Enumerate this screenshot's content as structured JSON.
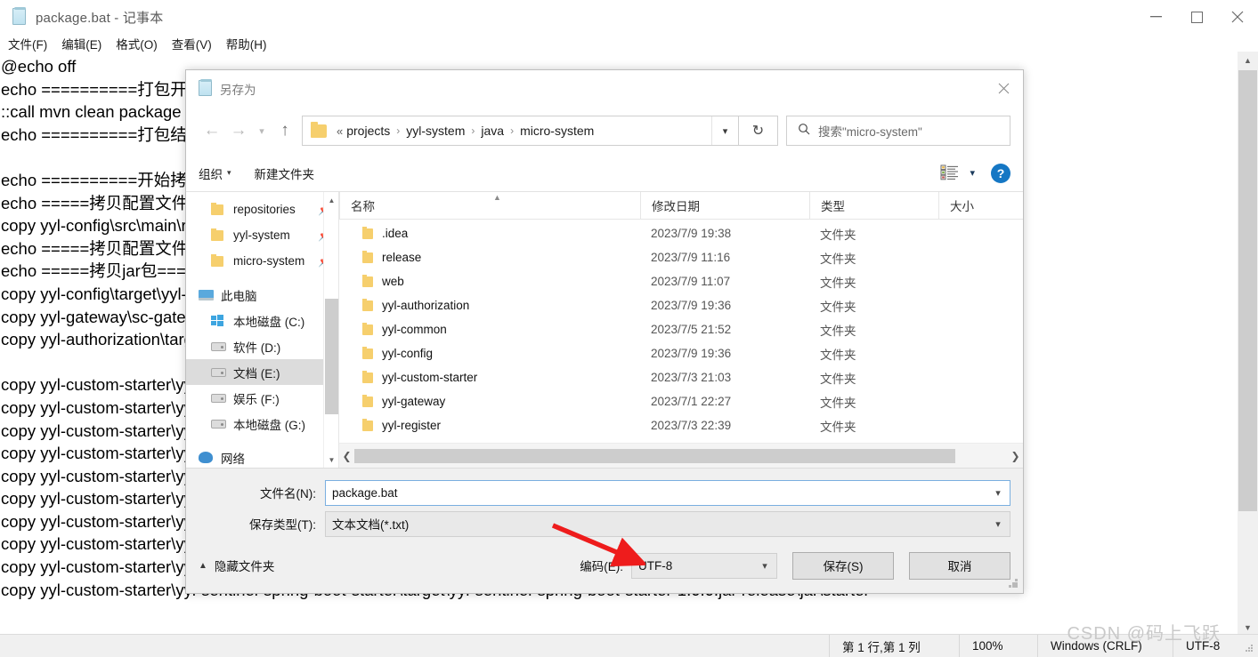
{
  "notepad": {
    "title": "package.bat - 记事本",
    "title_icon": "notepad-icon",
    "window_buttons": {
      "minimize": "minimize-icon",
      "maximize": "maximize-icon",
      "close": "close-icon"
    },
    "menu": [
      {
        "label": "文件(F)"
      },
      {
        "label": "编辑(E)"
      },
      {
        "label": "格式(O)"
      },
      {
        "label": "查看(V)"
      },
      {
        "label": "帮助(H)"
      }
    ],
    "text": "@echo off\necho ==========打包开始==========\n::call mvn clean package -Dmaven.test.skip=true\necho ==========打包结束==========\n\necho ==========开始拷贝==========\necho =====拷贝配置文件=====\ncopy yyl-config\\src\\main\\resources\\config release\\config\necho =====拷贝配置文件完成=====\necho =====拷贝jar包=====\ncopy yyl-config\\target\\yyl-config-1.0.0.jar release\\jar\ncopy yyl-gateway\\sc-gateway\\target\\sc-gateway-1.0.0.jar release\\jar\ncopy yyl-authorization\\target\\yyl-authorization-1.0.0.jar release\\jar\n\ncopy yyl-custom-starter\\yyl-cache-spring-boot-starter\\target\\yyl-cache-spring-boot-starter-1.0.0.jar release\\jar\\starter\ncopy yyl-custom-starter\\yyl-common-spring-boot-starter\\target\\yyl-common-spring-boot-starter-1.0.0.jar release\\jar\\starter\ncopy yyl-custom-starter\\yyl-datasource-spring-boot-starter\\target\\yyl-datasource-1.0.0.jar release\\jar\\starter\ncopy yyl-custom-starter\\yyl-feign-spring-boot-starter\\target\\yyl-feign-spring-boot-starter-1.0.0.jar release\\jar\\starter\ncopy yyl-custom-starter\\yyl-log-spring-boot-starter\\target\\yyl-log-spring-boot-starter-1.0.0.jar release\\jar\\starter\ncopy yyl-custom-starter\\yyl-mybatis-spring-boot-starter\\target\\yyl-mybatis-1.0.0.jar release\\jar\\starter\ncopy yyl-custom-starter\\yyl-oauth-spring-boot-starter\\target\\yyl-oauth-1.0.0.jar release\\jar\\starter\ncopy yyl-custom-starter\\yyl-rabbit-spring-boot-starter\\target\\yyl-rabbit-1.0.0.jar release\\jar\\starter\ncopy yyl-custom-starter\\yyl-redis-spring-boot-starter\\target\\yyl-redis-spring-boot-starter-1.0.0.jar release\\jar\\starter\ncopy yyl-custom-starter\\yyl-sentinel-spring-boot-starter\\target\\yyl-sentinel-spring-boot-starter-1.0.0.jar release\\jar\\starter",
    "statusbar": {
      "position": "第 1 行,第 1 列",
      "zoom": "100%",
      "line_ending": "Windows (CRLF)",
      "encoding": "UTF-8"
    },
    "watermark": "CSDN @码上飞跃"
  },
  "dialog": {
    "title": "另存为",
    "title_icon": "notepad-icon",
    "close_icon": "close-icon",
    "nav": {
      "back_icon": "arrow-left-icon",
      "forward_icon": "arrow-right-icon",
      "history_icon": "chevron-down-icon",
      "up_icon": "arrow-up-icon",
      "refresh_icon": "refresh-icon",
      "folder_icon": "folder-icon",
      "dropdown_icon": "chevron-down-icon",
      "breadcrumb_prefix": "«",
      "breadcrumbs": [
        "projects",
        "yyl-system",
        "java",
        "micro-system"
      ],
      "separator": "›"
    },
    "search": {
      "icon": "search-icon",
      "placeholder": "搜索\"micro-system\""
    },
    "toolbar": {
      "organize": "组织",
      "new_folder": "新建文件夹",
      "view_icon": "view-list-icon",
      "view_caret": "▾",
      "help_icon": "help-icon",
      "help_label": "?"
    },
    "sidebar": {
      "items": [
        {
          "label": "repositories",
          "icon": "folder-icon",
          "indent": true,
          "pinned": true,
          "selected": false
        },
        {
          "label": "yyl-system",
          "icon": "folder-icon",
          "indent": true,
          "pinned": true,
          "selected": false
        },
        {
          "label": "micro-system",
          "icon": "folder-icon",
          "indent": true,
          "pinned": true,
          "selected": false
        },
        {
          "label": "此电脑",
          "icon": "this-pc-icon",
          "indent": false,
          "pinned": false,
          "selected": false
        },
        {
          "label": "本地磁盘 (C:)",
          "icon": "windows-drive-icon",
          "indent": true,
          "pinned": false,
          "selected": false
        },
        {
          "label": "软件 (D:)",
          "icon": "drive-icon",
          "indent": true,
          "pinned": false,
          "selected": false
        },
        {
          "label": "文档 (E:)",
          "icon": "drive-icon",
          "indent": true,
          "pinned": false,
          "selected": true
        },
        {
          "label": "娱乐 (F:)",
          "icon": "drive-icon",
          "indent": true,
          "pinned": false,
          "selected": false
        },
        {
          "label": "本地磁盘 (G:)",
          "icon": "drive-icon",
          "indent": true,
          "pinned": false,
          "selected": false
        },
        {
          "label": "网络",
          "icon": "network-icon",
          "indent": false,
          "pinned": false,
          "selected": false
        }
      ],
      "scroll_up_icon": "chevron-up-icon",
      "scroll_down_icon": "chevron-down-icon"
    },
    "filelist": {
      "columns": [
        "名称",
        "修改日期",
        "类型",
        "大小"
      ],
      "sort_indicator": "▲",
      "rows": [
        {
          "name": ".idea",
          "date": "2023/7/9 19:38",
          "type": "文件夹",
          "size": ""
        },
        {
          "name": "release",
          "date": "2023/7/9 11:16",
          "type": "文件夹",
          "size": ""
        },
        {
          "name": "web",
          "date": "2023/7/9 11:07",
          "type": "文件夹",
          "size": ""
        },
        {
          "name": "yyl-authorization",
          "date": "2023/7/9 19:36",
          "type": "文件夹",
          "size": ""
        },
        {
          "name": "yyl-common",
          "date": "2023/7/5 21:52",
          "type": "文件夹",
          "size": ""
        },
        {
          "name": "yyl-config",
          "date": "2023/7/9 19:36",
          "type": "文件夹",
          "size": ""
        },
        {
          "name": "yyl-custom-starter",
          "date": "2023/7/3 21:03",
          "type": "文件夹",
          "size": ""
        },
        {
          "name": "yyl-gateway",
          "date": "2023/7/1 22:27",
          "type": "文件夹",
          "size": ""
        },
        {
          "name": "yyl-register",
          "date": "2023/7/3 22:39",
          "type": "文件夹",
          "size": ""
        }
      ],
      "hscroll_left_icon": "chevron-left-icon",
      "hscroll_right_icon": "chevron-right-icon"
    },
    "form": {
      "filename_label": "文件名(N):",
      "filename_value": "package.bat",
      "filetype_label": "保存类型(T):",
      "filetype_value": "文本文档(*.txt)",
      "hide_folders_label": "隐藏文件夹",
      "hide_folders_caret": "⌃",
      "encoding_label": "编码(E):",
      "encoding_value": "UTF-8",
      "save_button": "保存(S)",
      "cancel_button": "取消"
    },
    "annotation": {
      "arrow": "red-arrow-annotation",
      "color": "#ee1c1c"
    }
  }
}
